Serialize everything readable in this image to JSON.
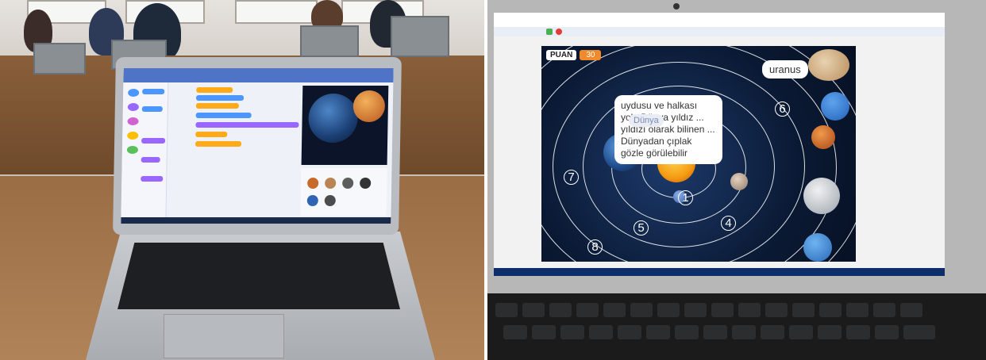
{
  "game": {
    "score_label": "PUAN",
    "score_value": "30",
    "uranus_label": "uranus",
    "earth_label": "Dünya",
    "info_bubble": "uydusu ve halkası yok. Dünya yıldız ... yıldızı olarak bilinen ... Dünyadan çıplak gözle görülebilir",
    "orbit_numbers": [
      "1",
      "4",
      "5",
      "6",
      "7",
      "8"
    ]
  },
  "colors": {
    "score_accent": "#f08a2a",
    "editor_accent": "#4f73c7",
    "space_bg": "#0a1933"
  }
}
